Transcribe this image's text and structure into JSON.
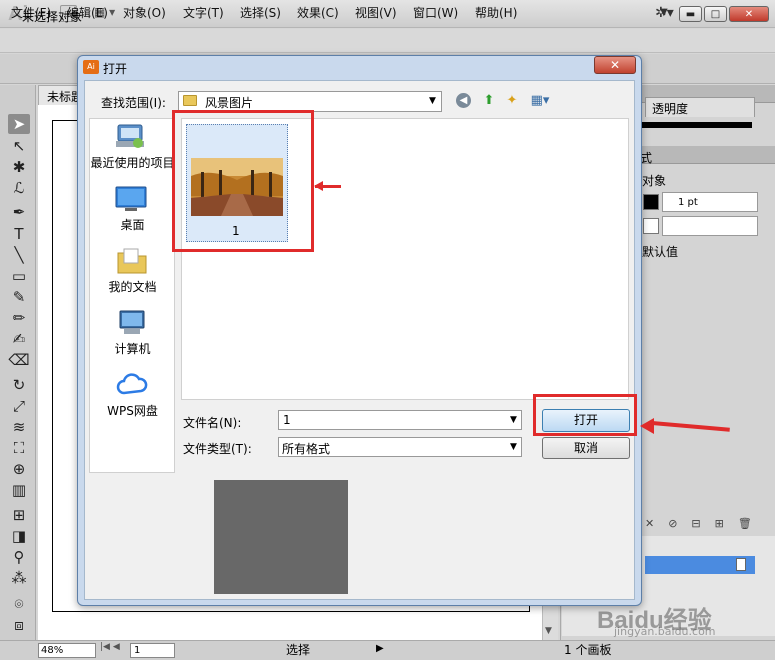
{
  "app": {
    "logo": "Ai",
    "bridge_badge": "Br",
    "menu": [
      "文件(F)",
      "编辑(E)",
      "对象(O)",
      "文字(T)",
      "选择(S)",
      "效果(C)",
      "视图(V)",
      "窗口(W)",
      "帮助(H)"
    ],
    "control_bar_text": "未选择对象",
    "doc_tab": "未标题",
    "panels": {
      "opacity_tab": "透明度",
      "object_label": "对象",
      "stroke_weight": "1 pt",
      "default_label": "默认值"
    },
    "status": {
      "zoom": "48%",
      "page": "1",
      "tool_status": "选择",
      "artboard_count": "1 个画板"
    }
  },
  "dialog": {
    "title": "打开",
    "look_in_label": "查找范围(I):",
    "look_in_value": "风景图片",
    "places": [
      {
        "label": "最近使用的项目",
        "icon": "recent-items-icon"
      },
      {
        "label": "桌面",
        "icon": "desktop-icon"
      },
      {
        "label": "我的文档",
        "icon": "documents-icon"
      },
      {
        "label": "计算机",
        "icon": "computer-icon"
      },
      {
        "label": "WPS网盘",
        "icon": "cloud-icon"
      }
    ],
    "files": [
      {
        "name": "1"
      }
    ],
    "file_name_label": "文件名(N):",
    "file_name_value": "1",
    "file_type_label": "文件类型(T):",
    "file_type_value": "所有格式",
    "open_button": "打开",
    "cancel_button": "取消"
  },
  "watermark": {
    "main": "Baidu经验",
    "sub": "jingyan.baidu.com"
  },
  "colors": {
    "annotation_red": "#e02b2b",
    "ai_orange": "#e56d15",
    "selection_blue": "#4b8be0"
  }
}
